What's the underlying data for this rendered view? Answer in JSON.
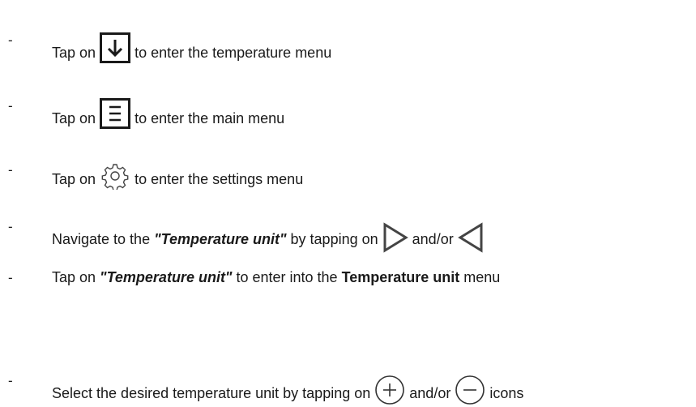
{
  "steps": [
    {
      "bullet": "-",
      "prefix": "Tap on",
      "suffix": "to enter the temperature menu",
      "icon": "down-arrow-box-icon"
    },
    {
      "bullet": "-",
      "prefix": "Tap on",
      "suffix": "to enter the main menu",
      "icon": "menu-box-icon"
    },
    {
      "bullet": "-",
      "prefix": "Tap on",
      "suffix": "to enter the settings menu",
      "icon": "gear-icon"
    },
    {
      "bullet": "-",
      "prefix": "Navigate to the ",
      "emph": "\"Temperature unit\"",
      "middle": " by tapping on",
      "conj": "and/or",
      "icon_a": "play-right-triangle-icon",
      "icon_b": "left-triangle-icon"
    },
    {
      "bullet": "-",
      "prefix": "Tap on ",
      "emph": "\"Temperature unit\"",
      "middle": " to enter into the ",
      "strong": "Temperature unit",
      "suffix": " menu"
    },
    {
      "bullet": "-",
      "prefix": "Select the desired temperature unit by tapping on",
      "conj": "and/or",
      "suffix": "icons",
      "icon_a": "plus-circle-icon",
      "icon_b": "minus-circle-icon"
    }
  ]
}
